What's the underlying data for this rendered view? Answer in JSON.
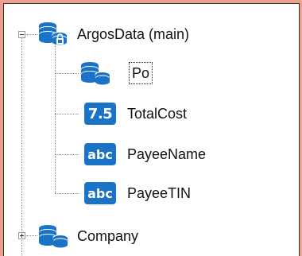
{
  "tree": {
    "root": {
      "label": "ArgosData (main)",
      "icon": "database-lock-icon",
      "expanded": true,
      "children": [
        {
          "label": "Po",
          "icon": "database-icon",
          "focused": true
        },
        {
          "label": "TotalCost",
          "icon": "numeric-field-icon",
          "badge": "7.5"
        },
        {
          "label": "PayeeName",
          "icon": "text-field-icon",
          "badge": "abc"
        },
        {
          "label": "PayeeTIN",
          "icon": "text-field-icon",
          "badge": "abc"
        }
      ]
    },
    "sibling": {
      "label": "Company",
      "icon": "database-icon",
      "expanded": false
    }
  },
  "colors": {
    "frame": "#e8a28f",
    "icon_blue": "#1a73c7",
    "connector": "#8a8a8a"
  }
}
